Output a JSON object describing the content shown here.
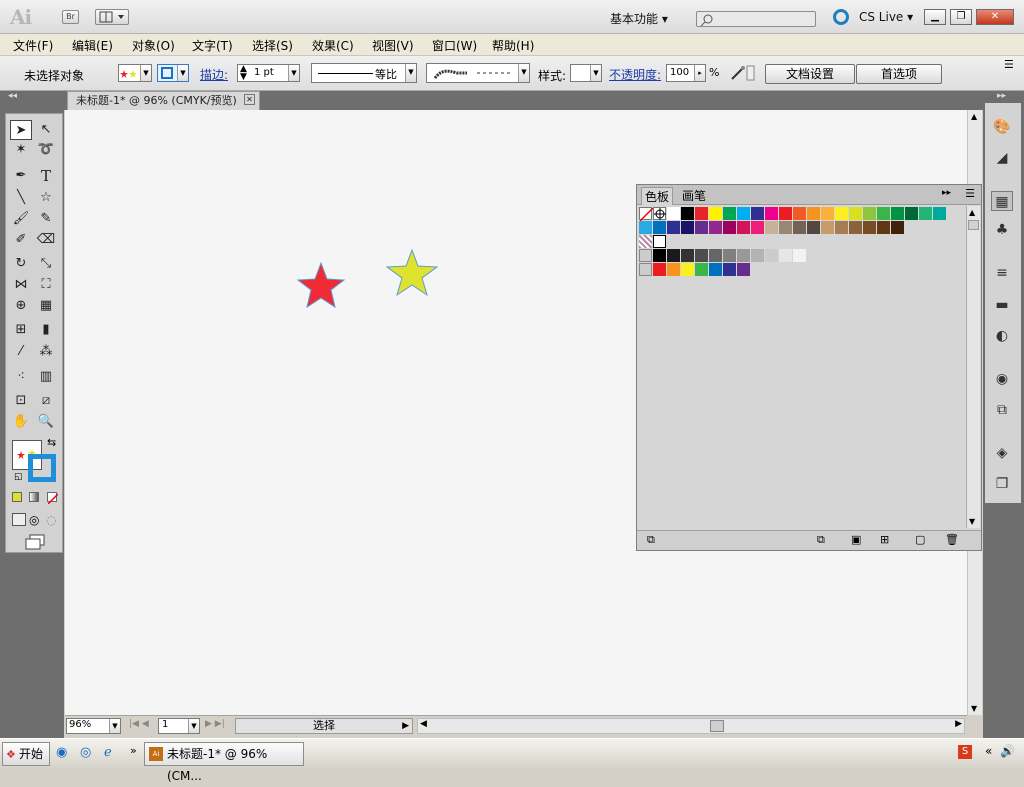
{
  "app": {
    "logo": "Ai",
    "bridge": "Br",
    "workspace": "基本功能 ▾",
    "cslive": "CS Live ▾"
  },
  "menu": [
    "文件(F)",
    "编辑(E)",
    "对象(O)",
    "文字(T)",
    "选择(S)",
    "效果(C)",
    "视图(V)",
    "窗口(W)",
    "帮助(H)"
  ],
  "control": {
    "selection_status": "未选择对象",
    "stroke_label": "描边:",
    "stroke_value": "1 pt",
    "stroke_profile": "等比",
    "style_label": "样式:",
    "opacity_label": "不透明度:",
    "opacity_value": "100",
    "opacity_unit": "%",
    "doc_setup": "文档设置",
    "preferences": "首选项"
  },
  "document": {
    "tab_title": "未标题-1* @ 96% (CMYK/预览)",
    "zoom": "96%",
    "page": "1",
    "status_text": "选择"
  },
  "swatch_panel": {
    "tab_swatches": "色板",
    "tab_brushes": "画笔",
    "row1": [
      "#ffffff",
      "#000000",
      "#e8242b",
      "#fff200",
      "#00a651",
      "#00aeef",
      "#2e3192",
      "#ec008c",
      "#ed1c24",
      "#f15a24",
      "#f7941d",
      "#fbb03b",
      "#fcee21",
      "#d9e021",
      "#8cc63f",
      "#39b54a",
      "#009245",
      "#006837",
      "#22b573",
      "#00a99d"
    ],
    "row2": [
      "#29abe2",
      "#0071bc",
      "#2e3192",
      "#1b1464",
      "#662d91",
      "#93278f",
      "#9e005d",
      "#d4145a",
      "#ed1e79",
      "#c7b299",
      "#998675",
      "#736357",
      "#534741",
      "#c69c6d",
      "#a67c52",
      "#8c6239",
      "#754c24",
      "#603813",
      "#42210b"
    ],
    "gray_row": [
      "#000000",
      "#1a1a1a",
      "#333333",
      "#4d4d4d",
      "#666666",
      "#808080",
      "#999999",
      "#b3b3b3",
      "#cccccc",
      "#e6e6e6",
      "#f2f2f2"
    ],
    "color_group": [
      "#ed1c24",
      "#f7941d",
      "#fcee21",
      "#39b54a",
      "#0071bc",
      "#2e3192",
      "#662d91"
    ]
  },
  "stars": [
    {
      "fill": "#ef2b35",
      "stroke": "#5a9bd4"
    },
    {
      "fill": "#dfe32d",
      "stroke": "#5a9bd4"
    }
  ],
  "taskbar": {
    "start": "开始",
    "task": "未标题-1* @ 96% (CM..."
  }
}
